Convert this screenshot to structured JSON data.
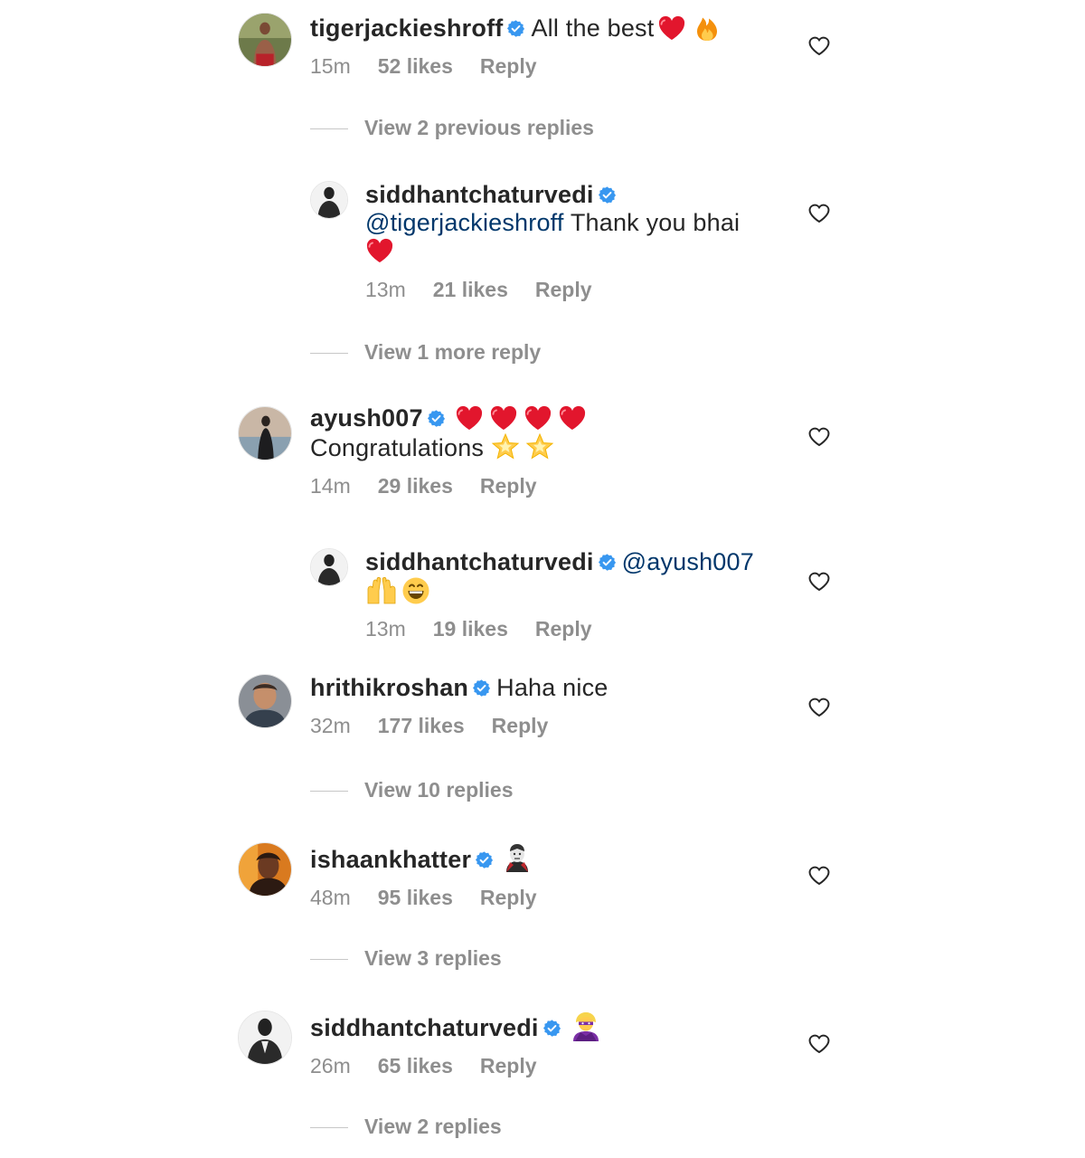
{
  "comments": [
    {
      "username": "tigerjackieshroff",
      "text": "All the best",
      "emoji": [
        "red-heart",
        "fire"
      ],
      "time": "15m",
      "likes": "52 likes",
      "reply": "Reply"
    },
    {
      "view_previous": "View 2 previous replies"
    },
    {
      "username": "siddhantchaturvedi",
      "mention": "@tigerjackieshroff",
      "text": "Thank you bhai",
      "emoji": [
        "red-heart"
      ],
      "time": "13m",
      "likes": "21 likes",
      "reply": "Reply"
    },
    {
      "view_more": "View 1 more reply"
    },
    {
      "username": "ayush007",
      "emoji_line1": [
        "red-heart",
        "red-heart",
        "red-heart",
        "red-heart"
      ],
      "text": "Congratulations",
      "emoji_line2": [
        "glowing-star",
        "glowing-star"
      ],
      "time": "14m",
      "likes": "29 likes",
      "reply": "Reply"
    },
    {
      "username": "siddhantchaturvedi",
      "mention": "@ayush007",
      "emoji": [
        "raising-hands",
        "grinning-face"
      ],
      "time": "13m",
      "likes": "19 likes",
      "reply": "Reply"
    },
    {
      "username": "hrithikroshan",
      "text": "Haha nice",
      "time": "32m",
      "likes": "177 likes",
      "reply": "Reply",
      "view_replies": "View 10 replies"
    },
    {
      "username": "ishaankhatter",
      "emoji": [
        "vampire"
      ],
      "time": "48m",
      "likes": "95 likes",
      "reply": "Reply",
      "view_replies": "View 3 replies"
    },
    {
      "username": "siddhantchaturvedi",
      "emoji": [
        "superhero"
      ],
      "time": "26m",
      "likes": "65 likes",
      "reply": "Reply",
      "view_replies": "View 2 replies"
    }
  ],
  "colors": {
    "verified": "#3897f0",
    "mention": "#00376b",
    "meta": "#8e8e8e",
    "heart": "#ed4956"
  }
}
